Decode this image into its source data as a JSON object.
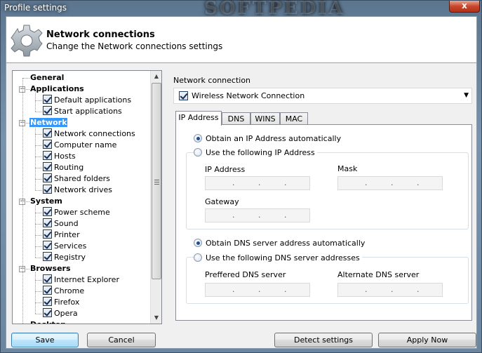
{
  "window": {
    "title": "Profile settings",
    "watermark": "SOFTPEDIA",
    "close_label": "x"
  },
  "header": {
    "title": "Network connections",
    "subtitle": "Change the Network connections settings",
    "icon": "gear-icon"
  },
  "tree": {
    "categories": [
      {
        "label": "General",
        "items": []
      },
      {
        "label": "Applications",
        "items": [
          "Default applications",
          "Start applications"
        ]
      },
      {
        "label": "Network",
        "selected": true,
        "items": [
          "Network connections",
          "Computer name",
          "Hosts",
          "Routing",
          "Shared folders",
          "Network drives"
        ]
      },
      {
        "label": "System",
        "items": [
          "Power scheme",
          "Sound",
          "Printer",
          "Services",
          "Registry"
        ]
      },
      {
        "label": "Browsers",
        "items": [
          "Internet Explorer",
          "Chrome",
          "Firefox",
          "Opera"
        ]
      },
      {
        "label": "Desktop",
        "items": []
      }
    ]
  },
  "connection": {
    "label": "Network connection",
    "selected": "Wireless Network Connection",
    "checked": true
  },
  "tabs": [
    "IP Address",
    "DNS",
    "WINS",
    "MAC"
  ],
  "ip": {
    "auto_label": "Obtain an IP Address automatically",
    "manual_label": "Use the following IP Address",
    "ip_label": "IP Address",
    "mask_label": "Mask",
    "gateway_label": "Gateway"
  },
  "dns": {
    "auto_label": "Obtain DNS server address automatically",
    "manual_label": "Use the following DNS server addresses",
    "preferred_label": "Preffered DNS server",
    "alternate_label": "Alternate DNS server"
  },
  "buttons": {
    "save": "Save",
    "cancel": "Cancel",
    "detect": "Detect settings",
    "apply": "Apply Now"
  },
  "colors": {
    "selection": "#3399ff",
    "close": "#c9472c"
  }
}
